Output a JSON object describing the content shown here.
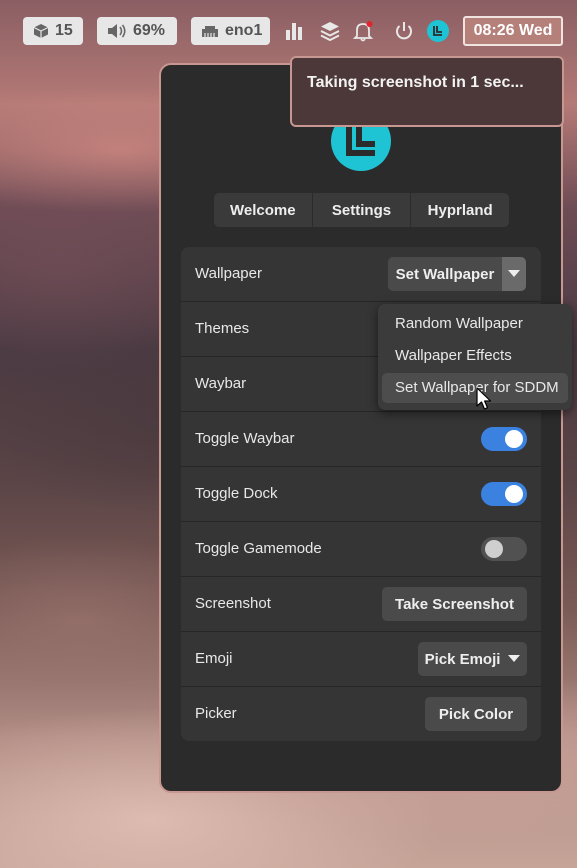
{
  "topbar": {
    "workspaces_count": "15",
    "volume": "69%",
    "network": "eno1",
    "clock": "08:26 Wed",
    "icons": [
      "package-icon",
      "speaker-icon",
      "ethernet-icon",
      "bar-chart-icon",
      "layers-icon",
      "bell-icon",
      "power-icon",
      "app-logo-icon"
    ],
    "notification_dot_color": "#e0242e"
  },
  "notification": {
    "text": "Taking screenshot in 1 sec..."
  },
  "window": {
    "logo_color": "#1fc4d4",
    "tabs": [
      "Welcome",
      "Settings",
      "Hyprland"
    ],
    "rows": {
      "wallpaper": {
        "label": "Wallpaper",
        "button": "Set Wallpaper"
      },
      "themes": {
        "label": "Themes"
      },
      "waybar": {
        "label": "Waybar"
      },
      "toggle_waybar": {
        "label": "Toggle Waybar",
        "on": true
      },
      "toggle_dock": {
        "label": "Toggle Dock",
        "on": true
      },
      "toggle_gamemode": {
        "label": "Toggle Gamemode",
        "on": false
      },
      "screenshot": {
        "label": "Screenshot",
        "button": "Take Screenshot"
      },
      "emoji": {
        "label": "Emoji",
        "button": "Pick Emoji"
      },
      "picker": {
        "label": "Picker",
        "button": "Pick Color"
      }
    },
    "accent_color": "#3b82e0"
  },
  "dropdown_menu": {
    "items": [
      "Random Wallpaper",
      "Wallpaper Effects",
      "Set Wallpaper for SDDM"
    ],
    "hovered_index": 2
  }
}
